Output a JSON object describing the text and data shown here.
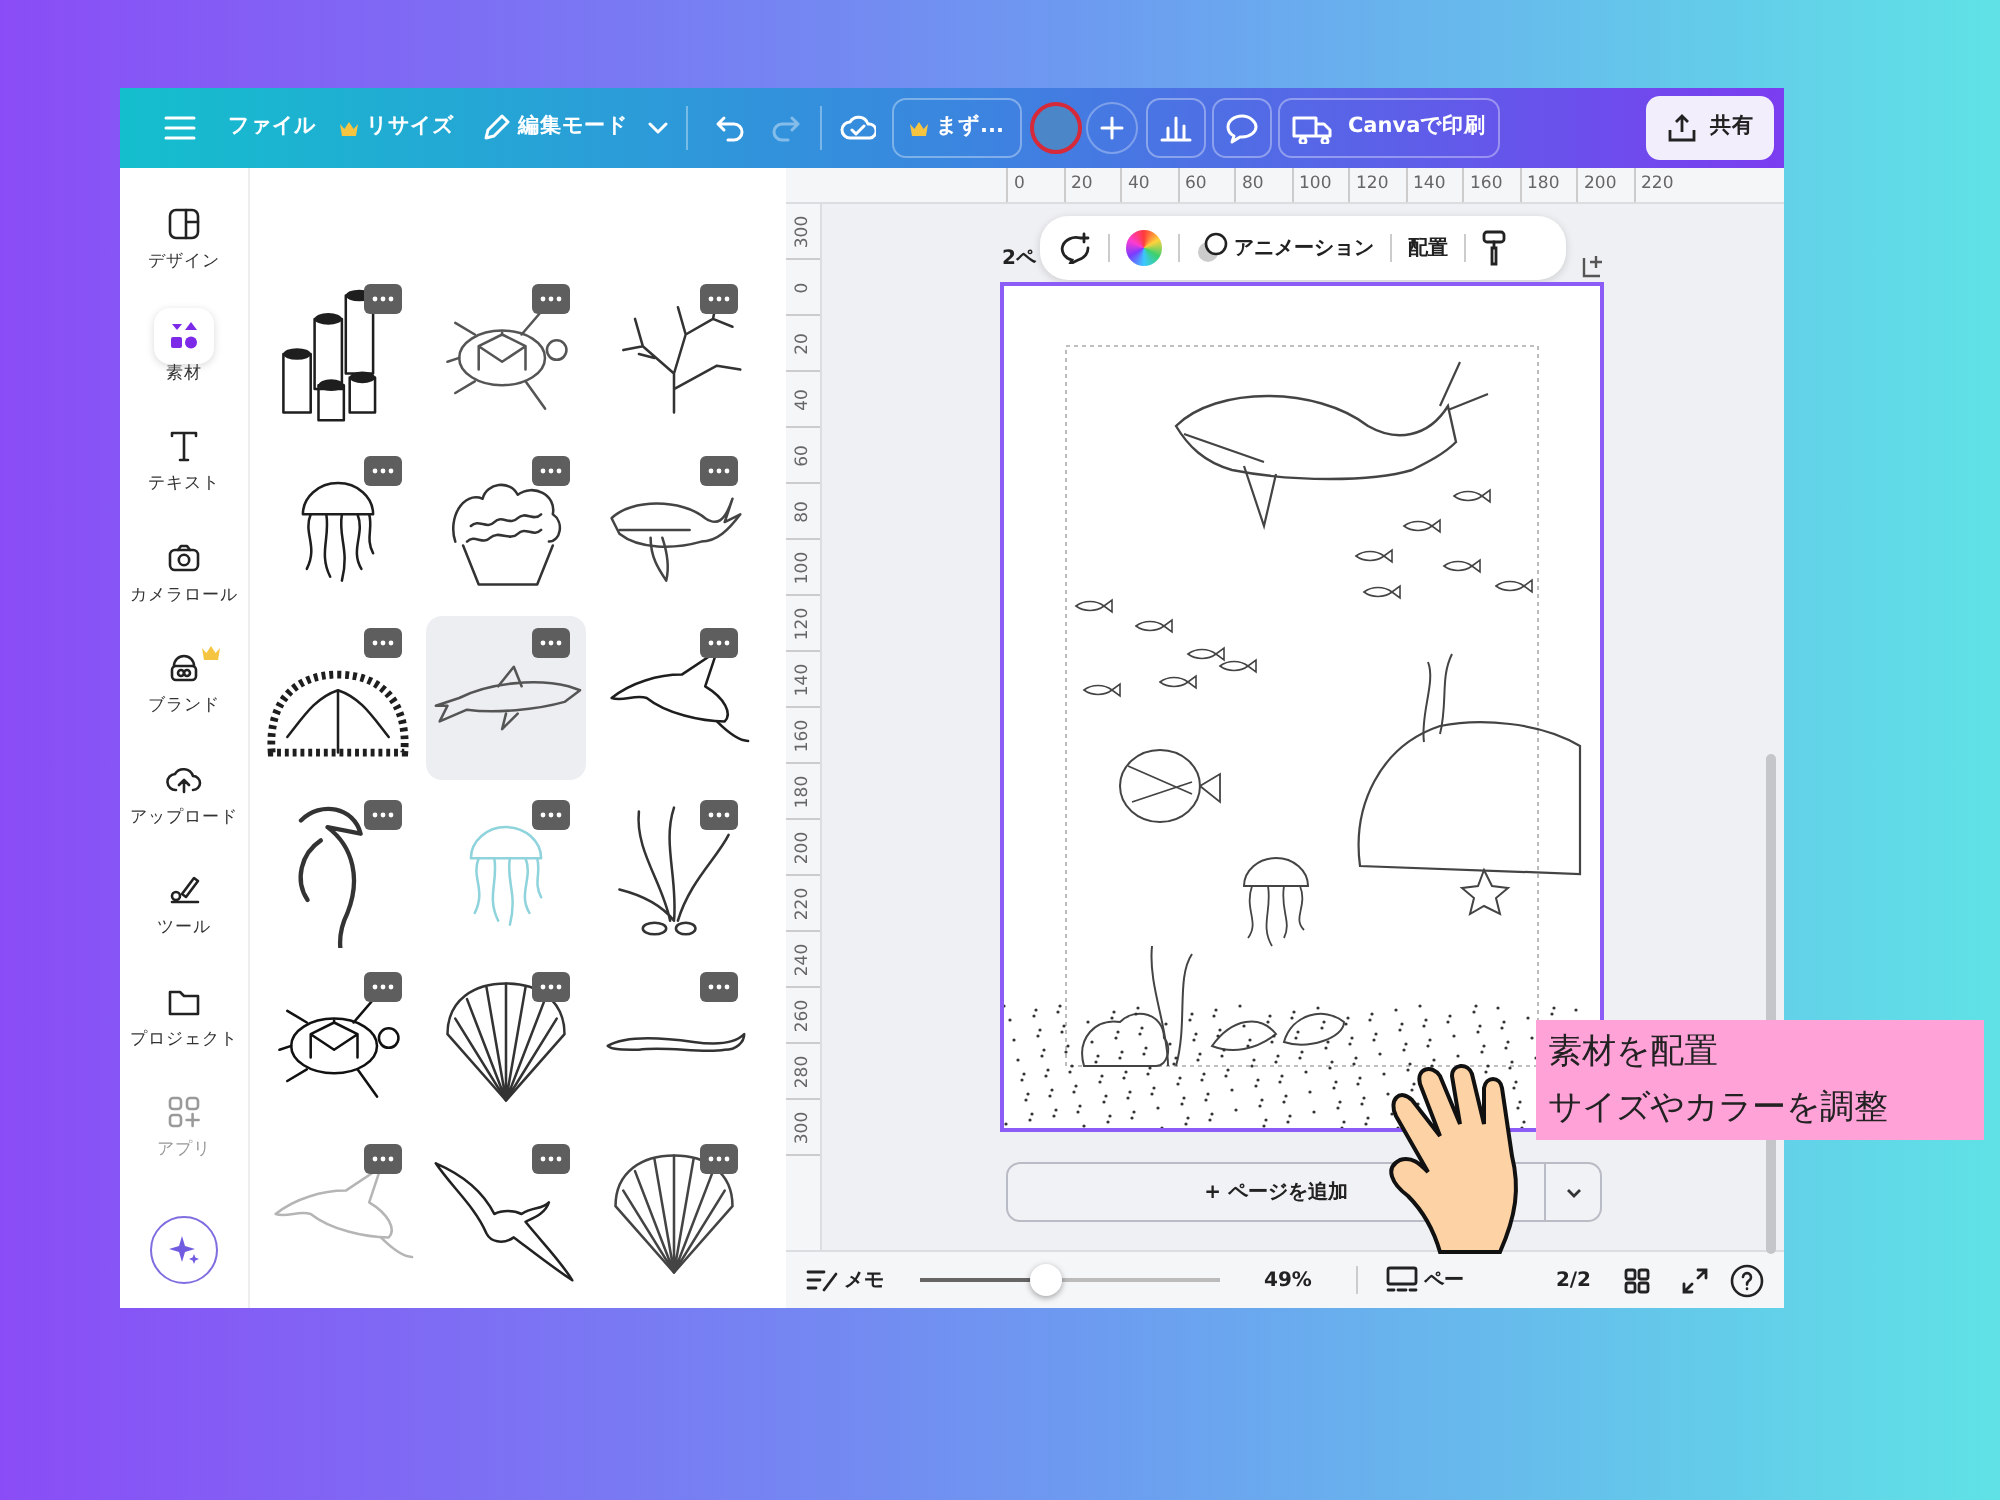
{
  "topbar": {
    "file": "ファイル",
    "resize": "リサイズ",
    "edit_mode": "編集モード",
    "redo": {
      "disabled": true
    },
    "draft": "まず...",
    "print": "Canvaで印刷",
    "share": "共有"
  },
  "rail": [
    {
      "kind": "design",
      "label": "デザイン",
      "selected": false,
      "premium": false,
      "disabled": false
    },
    {
      "kind": "elements",
      "label": "素材",
      "selected": true,
      "premium": false,
      "disabled": false
    },
    {
      "kind": "text",
      "label": "テキスト",
      "selected": false,
      "premium": false,
      "disabled": false
    },
    {
      "kind": "camera",
      "label": "カメラロール",
      "selected": false,
      "premium": false,
      "disabled": false
    },
    {
      "kind": "brand",
      "label": "ブランド",
      "selected": false,
      "premium": true,
      "disabled": false
    },
    {
      "kind": "upload",
      "label": "アップロード",
      "selected": false,
      "premium": false,
      "disabled": false
    },
    {
      "kind": "tools",
      "label": "ツール",
      "selected": false,
      "premium": false,
      "disabled": false
    },
    {
      "kind": "projects",
      "label": "プロジェクト",
      "selected": false,
      "premium": false,
      "disabled": false
    },
    {
      "kind": "apps",
      "label": "アプリ",
      "selected": false,
      "premium": false,
      "disabled": true
    }
  ],
  "elements": [
    {
      "kind": "sponge",
      "color": "#1e1e1e",
      "selected": false
    },
    {
      "kind": "turtle",
      "color": "#555555",
      "selected": false
    },
    {
      "kind": "coral",
      "color": "#333333",
      "selected": false
    },
    {
      "kind": "jellyfish",
      "color": "#1e1e1e",
      "selected": false
    },
    {
      "kind": "brain-coral",
      "color": "#333333",
      "selected": false
    },
    {
      "kind": "whale",
      "color": "#444444",
      "selected": false
    },
    {
      "kind": "bush-coral",
      "color": "#1e1e1e",
      "selected": false
    },
    {
      "kind": "shark",
      "color": "#555555",
      "selected": true
    },
    {
      "kind": "ray",
      "color": "#1e1e1e",
      "selected": false
    },
    {
      "kind": "seahorse",
      "color": "#333333",
      "selected": false
    },
    {
      "kind": "jellyfish",
      "color": "#8fd3dc",
      "selected": false
    },
    {
      "kind": "seaweed",
      "color": "#333333",
      "selected": false
    },
    {
      "kind": "turtle",
      "color": "#111111",
      "selected": false
    },
    {
      "kind": "shell",
      "color": "#333333",
      "selected": false
    },
    {
      "kind": "eel",
      "color": "#333333",
      "selected": false
    },
    {
      "kind": "ray",
      "color": "#b5b5b5",
      "selected": false
    },
    {
      "kind": "bird",
      "color": "#222222",
      "selected": false
    },
    {
      "kind": "shell",
      "color": "#444444",
      "selected": false
    }
  ],
  "rulers": {
    "horizontal": [
      "0",
      "20",
      "40",
      "60",
      "80",
      "100",
      "120",
      "140",
      "160",
      "180",
      "200",
      "220"
    ],
    "vertical": [
      "300",
      "0",
      "20",
      "40",
      "60",
      "80",
      "100",
      "120",
      "140",
      "160",
      "180",
      "200",
      "220",
      "240",
      "260",
      "280",
      "300"
    ]
  },
  "page_label": "2ペ",
  "floating_toolbar": {
    "animation": "アニメーション",
    "position": "配置"
  },
  "add_page": "+ ページを追加",
  "bottom_bar": {
    "notes": "メモ",
    "zoom": {
      "level": 0.42
    },
    "zoom_reading": "49%",
    "pages": "ペー",
    "page_count": "2/2"
  },
  "callout": {
    "lines": [
      "素材を配置",
      "サイズやカラーを調整"
    ]
  }
}
